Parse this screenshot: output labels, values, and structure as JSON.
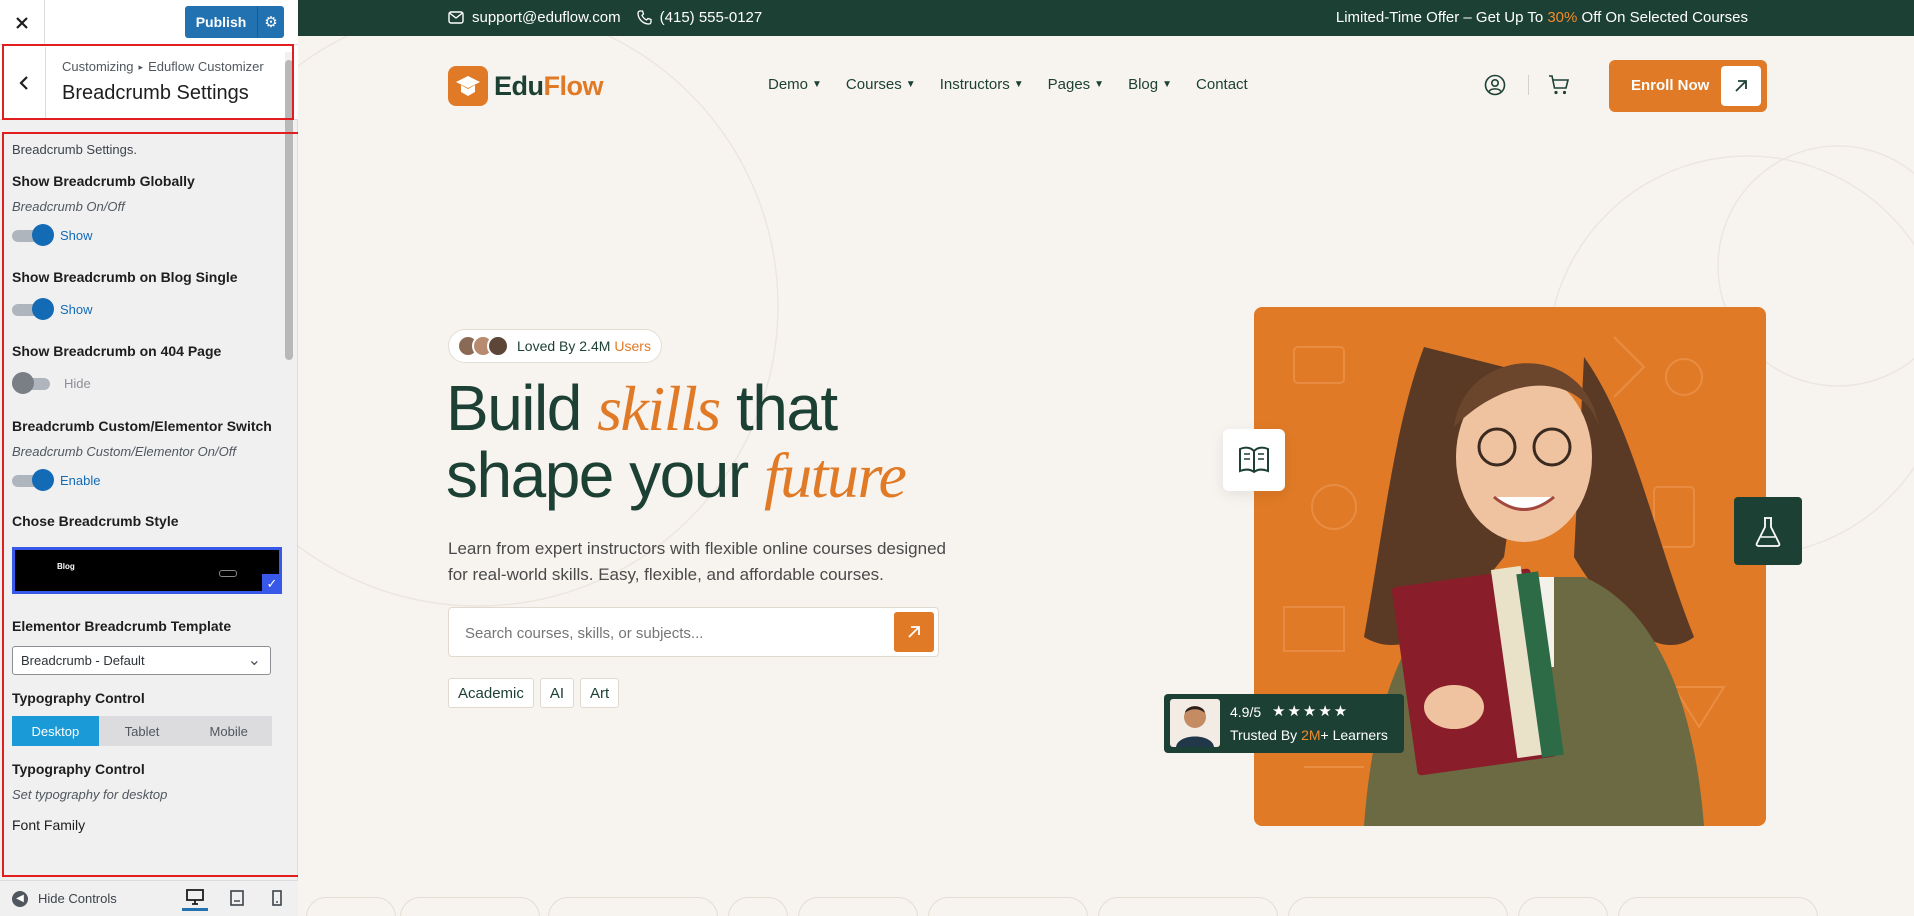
{
  "panel": {
    "close_icon": "close-icon",
    "publish_label": "Publish",
    "settings_icon": "gear-icon",
    "breadcrumb": {
      "root": "Customizing",
      "child": "Eduflow Customizer"
    },
    "section_title": "Breadcrumb Settings",
    "intro": "Breadcrumb Settings.",
    "controls": {
      "global": {
        "title": "Show Breadcrumb Globally",
        "desc": "Breadcrumb On/Off",
        "state": "on",
        "state_label": "Show"
      },
      "blog_single": {
        "title": "Show Breadcrumb on Blog Single",
        "state": "on",
        "state_label": "Show"
      },
      "page_404": {
        "title": "Show Breadcrumb on 404 Page",
        "state": "off",
        "state_label": "Hide"
      },
      "custom_switch": {
        "title": "Breadcrumb Custom/Elementor Switch",
        "desc": "Breadcrumb Custom/Elementor On/Off",
        "state": "on",
        "state_label": "Enable"
      },
      "style": {
        "title": "Chose Breadcrumb Style",
        "preview_text": "Blog"
      },
      "template": {
        "title": "Elementor Breadcrumb Template",
        "selected": "Breadcrumb - Default"
      },
      "typography_tabs": {
        "title": "Typography Control",
        "tabs": [
          "Desktop",
          "Tablet",
          "Mobile"
        ],
        "active": "Desktop"
      },
      "typography_desktop": {
        "title": "Typography Control",
        "desc": "Set typography for desktop"
      },
      "font_family_partial": "Font Family"
    },
    "footer": {
      "hide_controls": "Hide Controls",
      "devices": [
        "desktop-icon",
        "tablet-icon",
        "mobile-icon"
      ]
    }
  },
  "site": {
    "topbar": {
      "email": "support@eduflow.com",
      "phone": "(415) 555-0127",
      "offer_prefix": "Limited-Time Offer – Get Up To ",
      "offer_pct": "30%",
      "offer_suffix": " Off On Selected Courses"
    },
    "logo": {
      "part1": "Edu",
      "part2": "Flow"
    },
    "nav": [
      {
        "label": "Demo",
        "caret": true
      },
      {
        "label": "Courses",
        "caret": true
      },
      {
        "label": "Instructors",
        "caret": true
      },
      {
        "label": "Pages",
        "caret": true
      },
      {
        "label": "Blog",
        "caret": true
      },
      {
        "label": "Contact",
        "caret": false
      }
    ],
    "enroll_label": "Enroll Now",
    "hero": {
      "loved_prefix": "Loved By 2.4M",
      "loved_users": "Users",
      "title_1a": "Build ",
      "title_1b": "skills",
      "title_1c": " that",
      "title_2a": "shape your ",
      "title_2b": "future",
      "subtitle": "Learn from expert instructors with flexible online courses designed for real-world skills. Easy, flexible, and affordable courses.",
      "search_placeholder": "Search courses, skills, or subjects...",
      "tags": [
        "Academic",
        "AI",
        "Art"
      ],
      "rating_score": "4.9/5",
      "rating_stars": "★★★★★",
      "rating_value": 4.9,
      "trusted_prefix": "Trusted By ",
      "trusted_hl": "2M",
      "trusted_suffix": "+ Learners"
    },
    "colors": {
      "brand_green": "#1d4035",
      "brand_orange": "#e07a26",
      "customizer_blue": "#2271b1"
    }
  }
}
